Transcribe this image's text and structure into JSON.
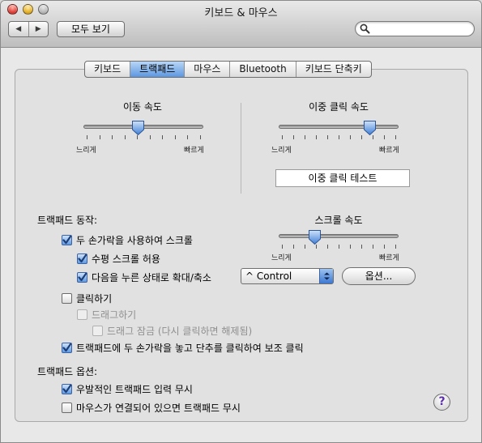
{
  "window": {
    "title": "키보드 & 마우스"
  },
  "toolbar": {
    "back_glyph": "◀",
    "forward_glyph": "▶",
    "show_all_label": "모두 보기",
    "search_value": "",
    "search_placeholder": ""
  },
  "tabs": [
    {
      "label": "키보드",
      "selected": false
    },
    {
      "label": "트랙패드",
      "selected": true
    },
    {
      "label": "마우스",
      "selected": false
    },
    {
      "label": "Bluetooth",
      "selected": false
    },
    {
      "label": "키보드 단축키",
      "selected": false
    }
  ],
  "tracking_speed": {
    "label": "이동 속도",
    "min_label": "느리게",
    "max_label": "빠르게",
    "value": 0.45,
    "ticks": 10
  },
  "double_click_speed": {
    "label": "이중 클릭 속도",
    "min_label": "느리게",
    "max_label": "빠르게",
    "value": 0.76,
    "ticks": 11,
    "test_label": "이중 클릭 테스트"
  },
  "gestures": {
    "heading": "트랙패드 동작:",
    "scroll_two_fingers": {
      "label": "두 손가락을 사용하여 스크롤",
      "checked": true
    },
    "horizontal_scroll": {
      "label": "수평 스크롤 허용",
      "checked": true
    },
    "zoom_with_modifier": {
      "label": "다음을 누른 상태로 확대/축소",
      "checked": true
    },
    "modifier_popup": {
      "value": "^ Control"
    },
    "options_button": "옵션...",
    "clicking": {
      "label": "클릭하기",
      "checked": false
    },
    "dragging": {
      "label": "드래그하기",
      "checked": false,
      "enabled": false
    },
    "drag_lock": {
      "label": "드래그 잠금 (다시 클릭하면 해제됨)",
      "checked": false,
      "enabled": false
    },
    "secondary_click": {
      "label": "트랙패드에 두 손가락을 놓고 단추를 클릭하여 보조 클릭",
      "checked": true
    }
  },
  "scroll_speed": {
    "label": "스크롤 속도",
    "min_label": "느리게",
    "max_label": "빠르게",
    "value": 0.3,
    "ticks": 11
  },
  "trackpad_options": {
    "heading": "트랙패드 옵션:",
    "ignore_accidental": {
      "label": "우발적인 트랙패드 입력 무시",
      "checked": true
    },
    "ignore_when_mouse": {
      "label": "마우스가 연결되어 있으면 트랙패드 무시",
      "checked": false
    }
  },
  "help_glyph": "?",
  "colors": {
    "accent": "#5c97e0",
    "check": "#1c3f78",
    "help": "#5b2fa8"
  }
}
